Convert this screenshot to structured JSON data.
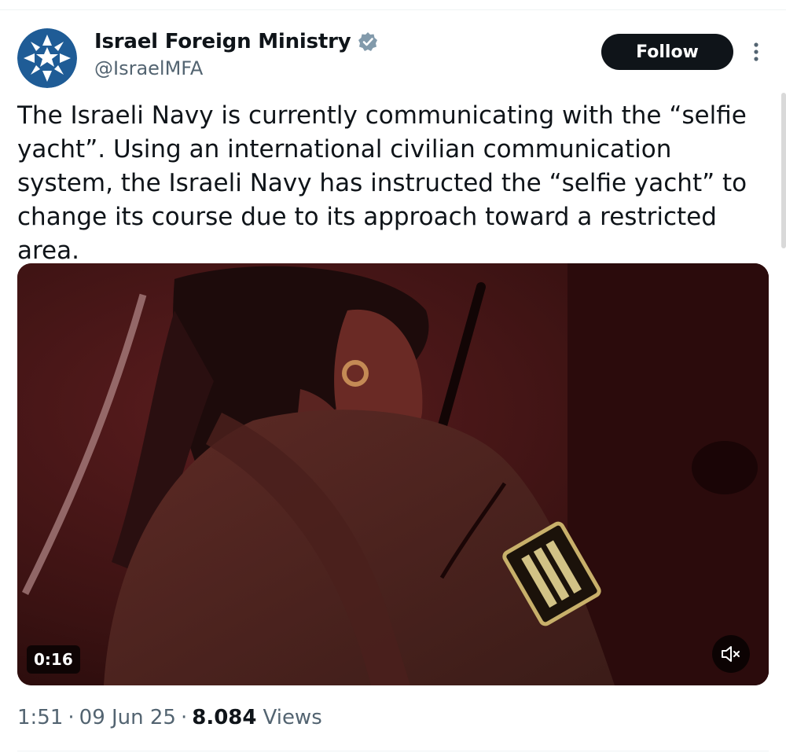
{
  "author": {
    "display_name": "Israel Foreign Ministry",
    "handle": "@IsraelMFA",
    "verified_icon": "verified-badge-icon",
    "avatar_icon": "ministry-emblem-icon"
  },
  "actions": {
    "follow_label": "Follow",
    "more_icon": "more-vertical-icon"
  },
  "tweet": {
    "text": "The Israeli Navy is currently communicating with the “selfie yacht”. Using an international civilian communication system, the Israeli Navy has instructed the “selfie yacht” to change its course due to its approach toward a restricted area."
  },
  "media": {
    "type": "video",
    "duration": "0:16",
    "mute_icon": "volume-muted-icon"
  },
  "meta": {
    "time": "1:51",
    "separator": "·",
    "date": "09 Jun 25",
    "views_count": "8.084",
    "views_label": "Views"
  },
  "colors": {
    "text_primary": "#0f1419",
    "text_secondary": "#536471",
    "verified_badge": "#829aab",
    "avatar_blue": "#1f5c96",
    "follow_bg": "#0f1419"
  }
}
